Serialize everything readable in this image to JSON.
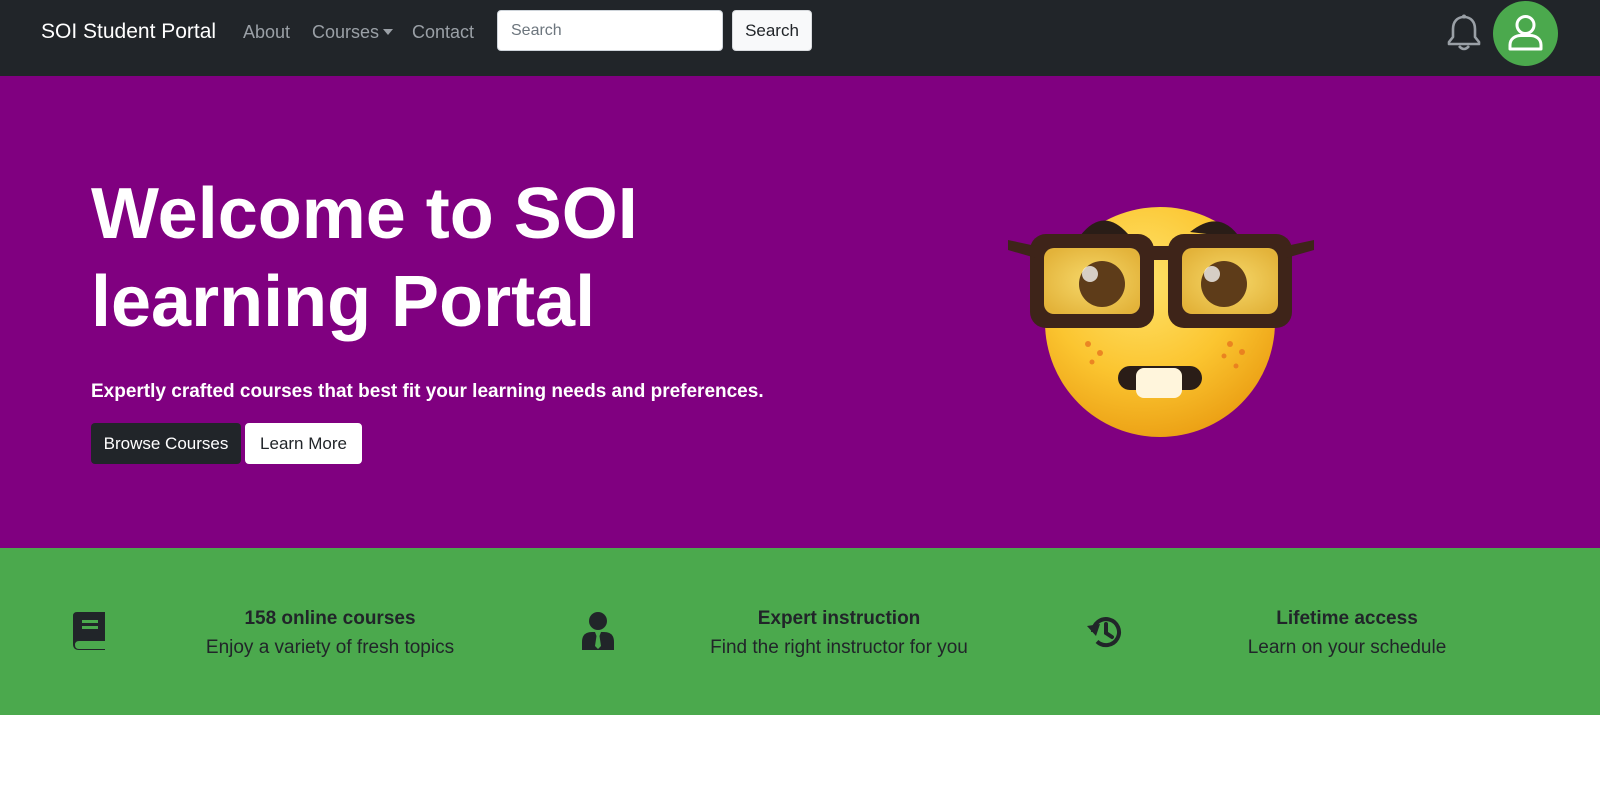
{
  "navbar": {
    "brand": "SOI Student Portal",
    "links": {
      "about": "About",
      "courses": "Courses",
      "contact": "Contact"
    },
    "search": {
      "placeholder": "Search",
      "value": "",
      "button_label": "Search"
    },
    "icons": {
      "notifications": "bell-icon",
      "profile": "user-avatar-icon"
    },
    "colors": {
      "background": "#212529",
      "avatar": "#4ba94d"
    }
  },
  "hero": {
    "title": "Welcome to SOI learning Portal",
    "subtitle": "Expertly crafted courses that best fit your learning needs and preferences.",
    "browse_label": "Browse Courses",
    "learn_label": "Learn More",
    "illustration": "nerd-face-emoji",
    "background": "#800080"
  },
  "features": {
    "background": "#4ba94d",
    "items": [
      {
        "icon": "book-icon",
        "title": "158 online courses",
        "desc": "Enjoy a variety of fresh topics"
      },
      {
        "icon": "instructor-icon",
        "title": "Expert instruction",
        "desc": "Find the right instructor for you"
      },
      {
        "icon": "history-icon",
        "title": "Lifetime access",
        "desc": "Learn on your schedule"
      }
    ]
  }
}
